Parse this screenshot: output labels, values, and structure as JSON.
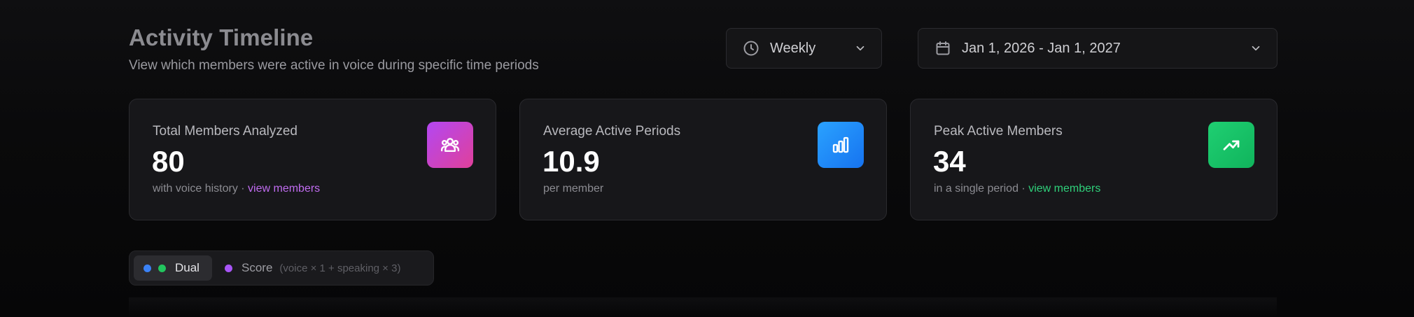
{
  "header": {
    "title": "Activity Timeline",
    "subtitle": "View which members were active in voice during specific time periods"
  },
  "controls": {
    "period": {
      "icon": "clock-icon",
      "value": "Weekly"
    },
    "date_range": {
      "icon": "calendar-icon",
      "value": "Jan 1, 2026 - Jan 1, 2027"
    }
  },
  "stats": [
    {
      "label": "Total Members Analyzed",
      "value": "80",
      "sub": "with voice history",
      "separator": " · ",
      "link": "view members",
      "icon": "users-icon",
      "color": "#c06cf0"
    },
    {
      "label": "Average Active Periods",
      "value": "10.9",
      "sub": "per member",
      "icon": "bar-chart-icon",
      "color": "#1d8cf8"
    },
    {
      "label": "Peak Active Members",
      "value": "34",
      "sub": "in a single period",
      "separator": " · ",
      "link": "view members",
      "icon": "trending-up-icon",
      "color": "#2fd07a"
    }
  ],
  "mode_toggle": {
    "dual": {
      "label": "Dual",
      "selected": true,
      "colors": [
        "#3b82f6",
        "#22c55e"
      ]
    },
    "score": {
      "label": "Score",
      "hint": "(voice × 1 + speaking × 3)",
      "selected": false,
      "color": "#a855f7"
    }
  }
}
